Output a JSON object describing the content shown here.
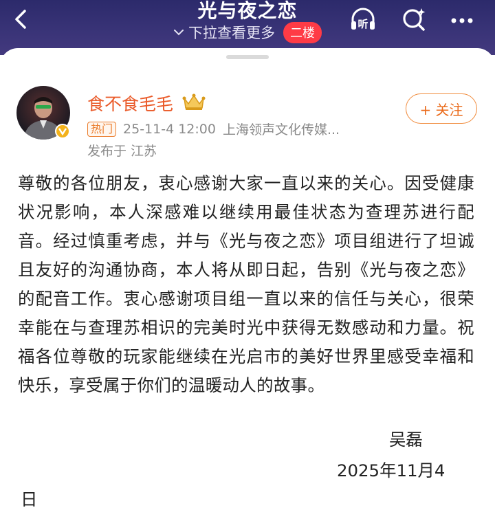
{
  "header": {
    "title": "光与夜之恋",
    "pull_hint": "下拉查看更多",
    "floor_badge": "二楼",
    "listen_label": "听"
  },
  "post": {
    "username": "食不食毛毛",
    "hot_tag": "热门",
    "timestamp": "25-11-4 12:00",
    "source": "上海领声文化传媒...",
    "location": "发布于 江苏",
    "follow_label": "+ 关注",
    "body": "尊敬的各位朋友，衷心感谢大家一直以来的关心。因受健康状况影响，本人深感难以继续用最佳状态为查理苏进行配音。经过慎重考虑，并与《光与夜之恋》项目组进行了坦诚且友好的沟通协商，本人将从即日起，告别《光与夜之恋》的配音工作。衷心感谢项目组一直以来的信任与关心，很荣幸能在与查理苏相识的完美时光中获得无数感动和力量。祝福各位尊敬的玩家能继续在光启市的美好世界里感受幸福和快乐，享受属于你们的温暖动人的故事。",
    "signature_name": "吴磊",
    "signature_date": "2025年11月4",
    "signature_day": "日"
  },
  "colors": {
    "header_bg": "#3a3478",
    "accent_orange": "#ea5b2a",
    "badge_red": "#ff3b46"
  }
}
